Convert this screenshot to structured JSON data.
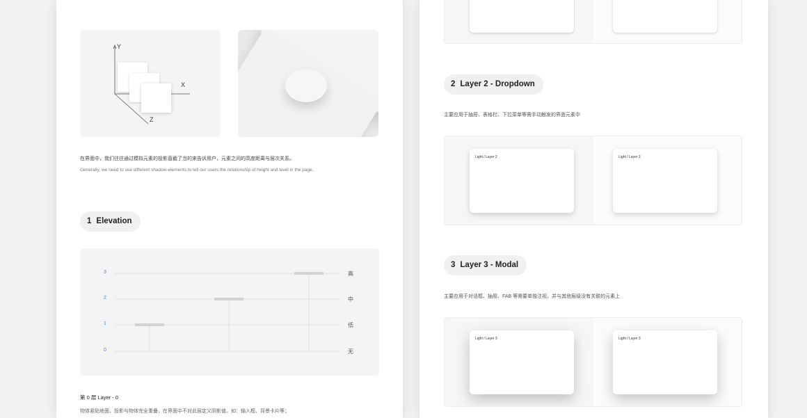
{
  "left_page": {
    "axes": {
      "y": "Y",
      "x": "X",
      "z": "Z"
    },
    "intro_cn": "在界面中，我们往往通过模拟元素的投影直截了当的来告诉用户，元素之间的高度距离与层次关系。",
    "intro_en": "Generally, we need to use different shadow-elements to tell our users the relationship of height and level in the page.",
    "section1": {
      "number": "1",
      "title": "Elevation"
    },
    "elevation_chart": {
      "levels": [
        {
          "value": "3",
          "label": "高"
        },
        {
          "value": "2",
          "label": "中"
        },
        {
          "value": "1",
          "label": "低"
        },
        {
          "value": "0",
          "label": "无"
        }
      ]
    },
    "layer0": {
      "title": "第 0 层 Layer - 0",
      "desc": "物体紧贴地面，投影与物体完全重叠，在界面中不对此层定义阴影值。如：输入框、背景卡片等；"
    }
  },
  "right_page": {
    "section2": {
      "number": "2",
      "title": "Layer 2 - Dropdown",
      "desc": "主要应用于抽屉、表格栏、下拉菜单等需手动触发的界面元素中",
      "card_labels": [
        "Light / Layer 2",
        "Light / Layer 2"
      ]
    },
    "section3": {
      "number": "3",
      "title": "Layer 3 - Modal",
      "desc": "主要应用于对话框、抽屉、FAB 等需要单独注视，并与其他层级没有关联的元素上",
      "card_labels": [
        "Light / Layer 3",
        "Light / Layer 3"
      ]
    }
  },
  "colors": {
    "tick_blue": "#3a87d8",
    "page_bg": "#f2f2f2"
  }
}
